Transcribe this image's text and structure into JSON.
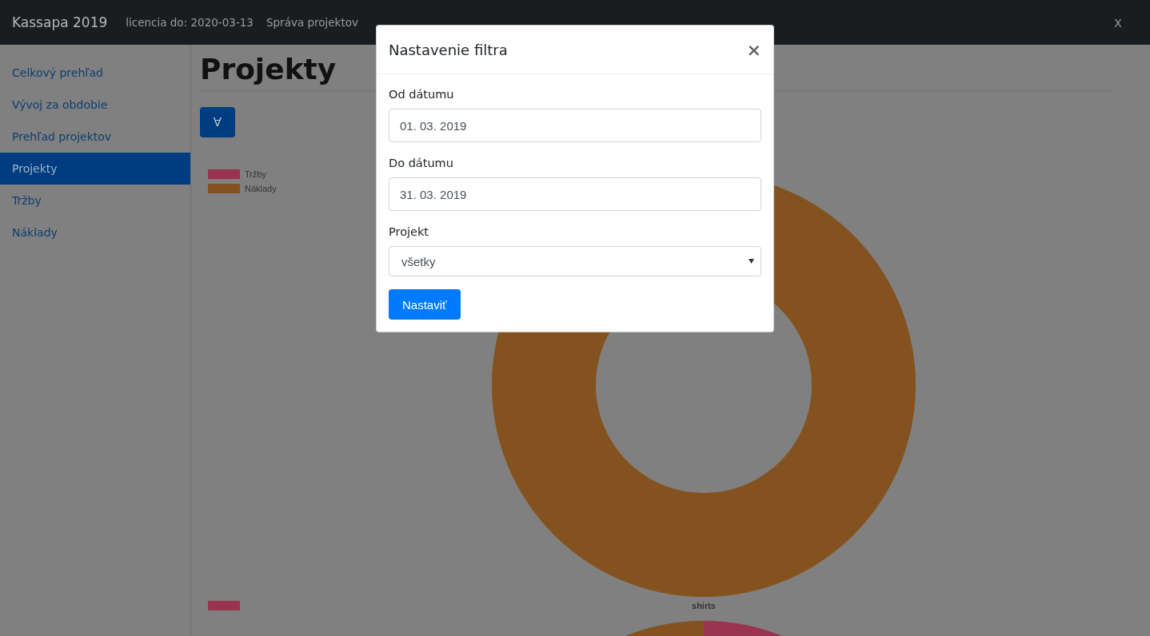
{
  "navbar": {
    "brand": "Kassapa 2019",
    "license": "licencia do: 2020-03-13",
    "links": [
      "Správa projektov"
    ],
    "close": "x"
  },
  "sidebar": {
    "items": [
      {
        "label": "Celkový prehľad",
        "selected": false
      },
      {
        "label": "Vývoj za obdobie",
        "selected": false
      },
      {
        "label": "Prehľad projektov",
        "selected": false
      },
      {
        "label": "Projekty",
        "selected": true
      },
      {
        "label": "Tržby",
        "selected": false
      },
      {
        "label": "Náklady",
        "selected": false
      }
    ]
  },
  "page": {
    "title": "Projekty",
    "filter_button": "∀"
  },
  "charts": [
    {
      "legend": [
        {
          "label": "Tržby",
          "color": "#993350"
        },
        {
          "label": "Náklady",
          "color": "#84521f"
        }
      ],
      "slices": [
        {
          "color": "#84521f"
        }
      ]
    },
    {
      "title": "shirts",
      "legend": [
        {
          "color": "#993350"
        }
      ],
      "slices": [
        {
          "color": "#993350"
        },
        {
          "color": "#84521f"
        }
      ]
    }
  ],
  "modal": {
    "title": "Nastavenie filtra",
    "close": "×",
    "fields": [
      {
        "kind": "date",
        "label": "Od dátumu",
        "value": "01. 03. 2019"
      },
      {
        "kind": "date",
        "label": "Do dátumu",
        "value": "31. 03. 2019"
      },
      {
        "kind": "select",
        "label": "Projekt",
        "value": "všetky"
      }
    ],
    "submit": "Nastaviť"
  }
}
